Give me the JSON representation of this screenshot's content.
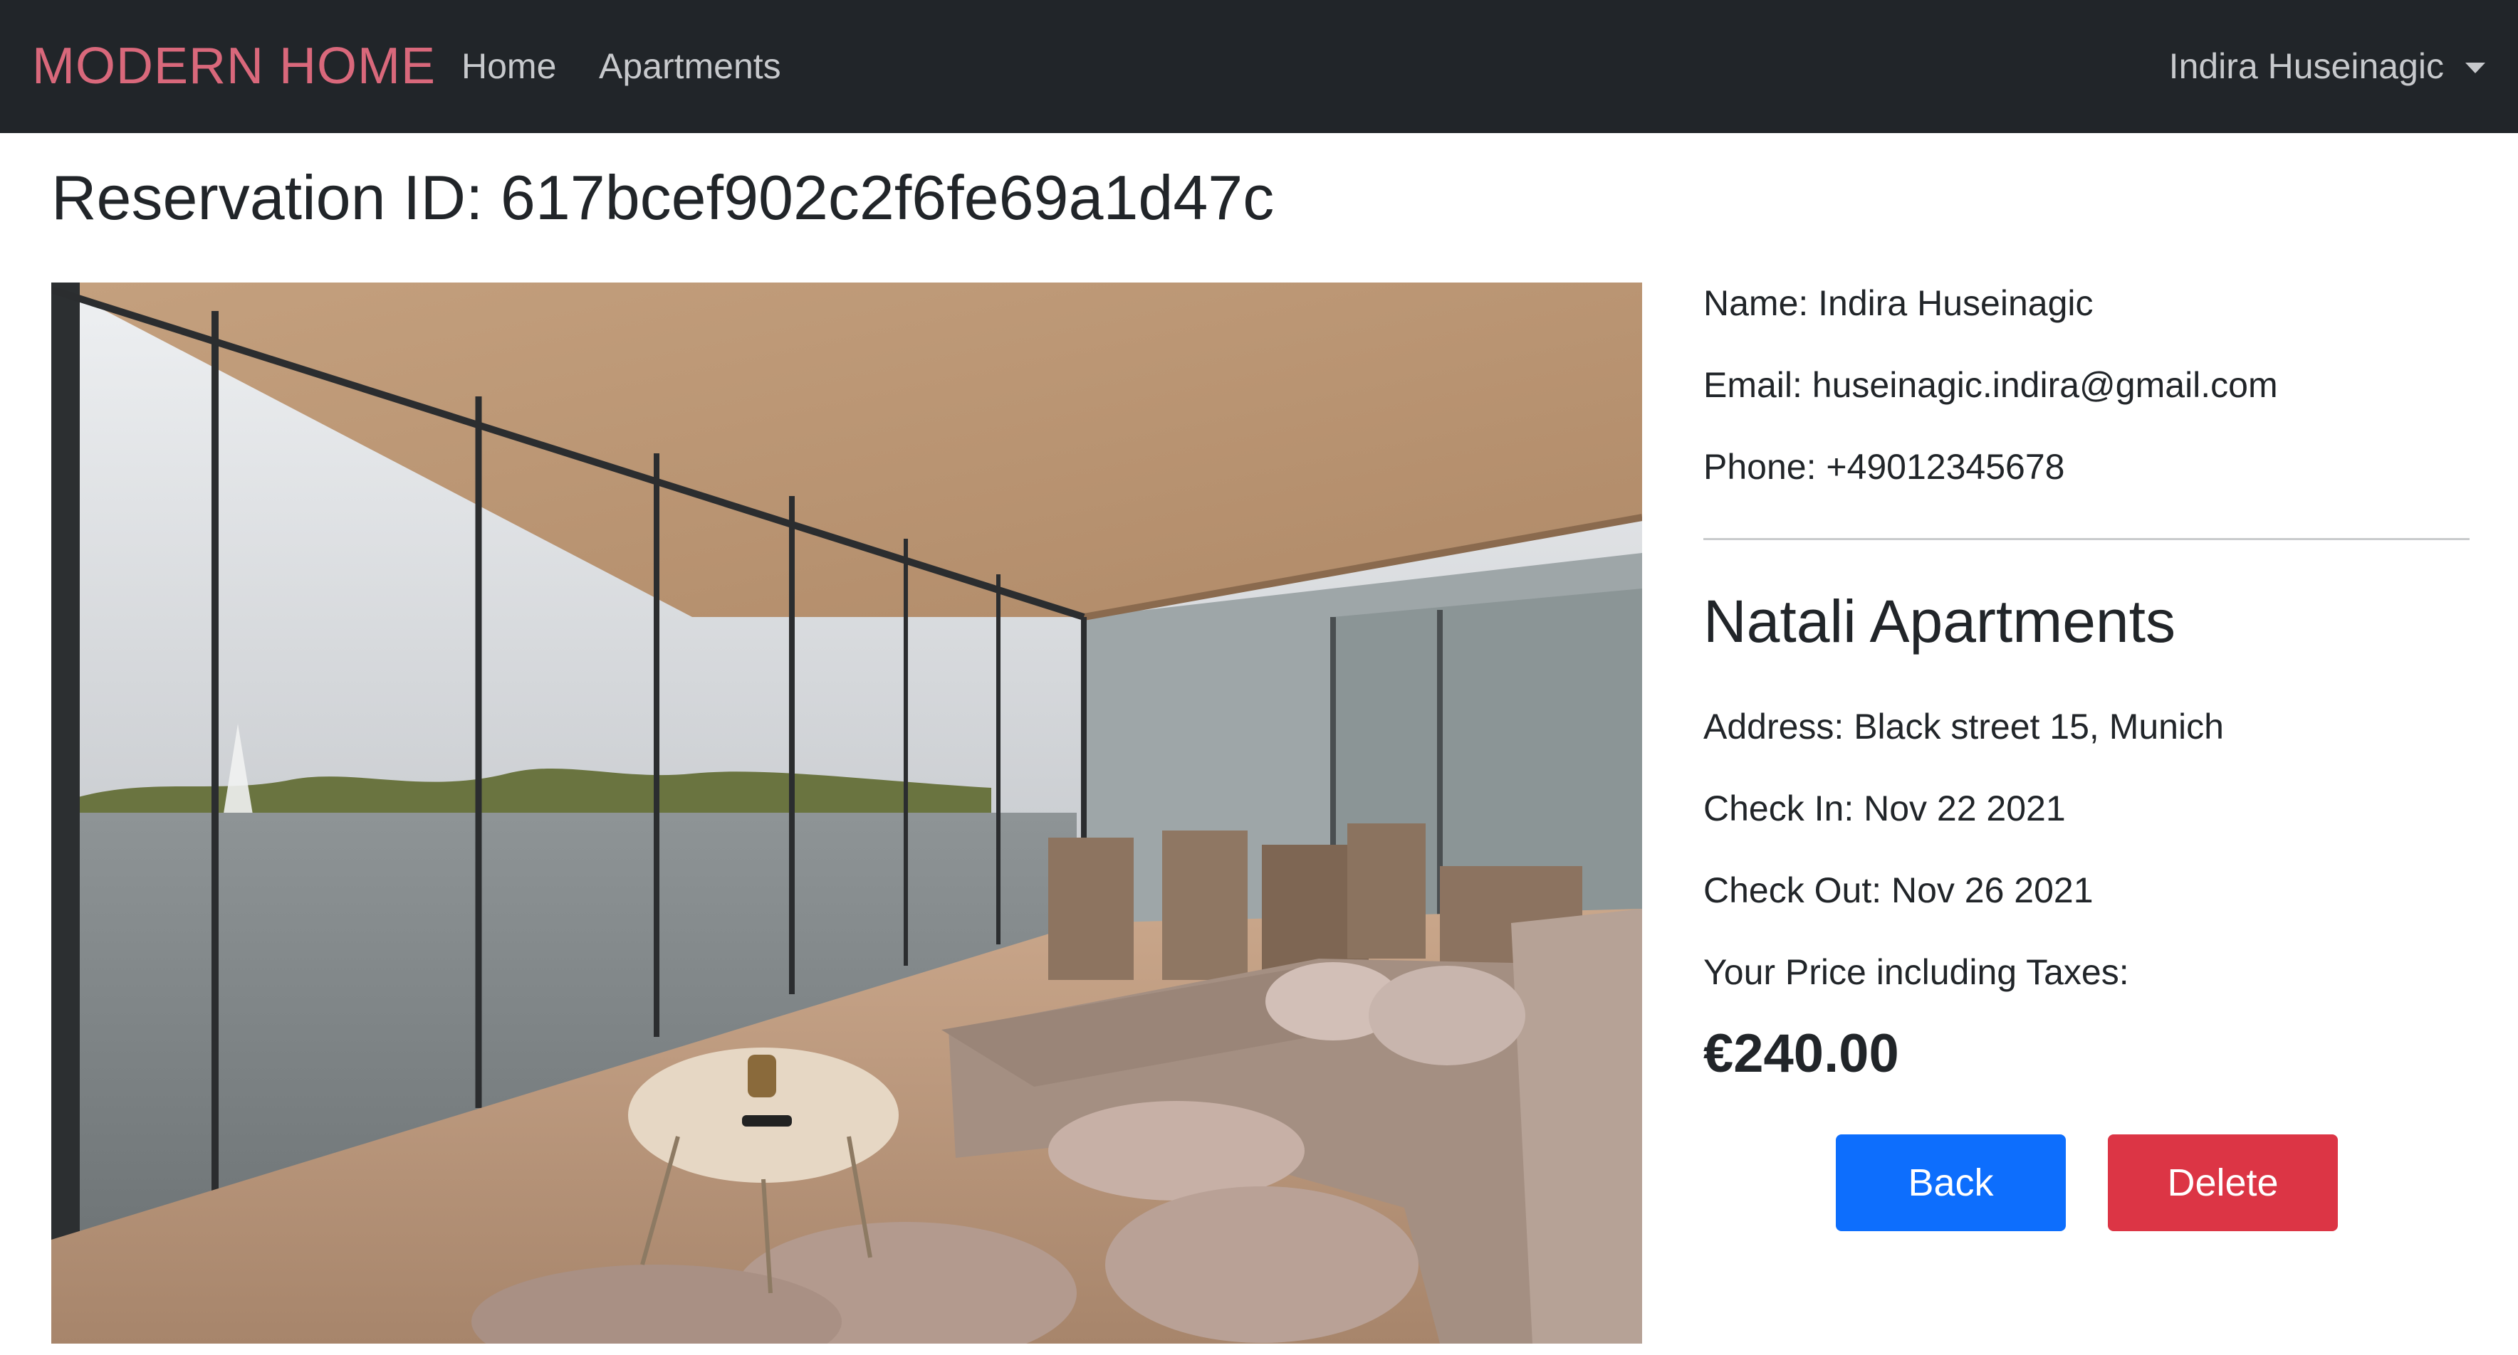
{
  "navbar": {
    "brand": "MODERN HOME",
    "links": [
      "Home",
      "Apartments"
    ],
    "user": "Indira Huseinagic"
  },
  "page": {
    "title": "Reservation ID: 617bcef902c2f6fe69a1d47c"
  },
  "guest": {
    "name": "Name: Indira Huseinagic",
    "email": "Email: huseinagic.indira@gmail.com",
    "phone": "Phone: +49012345678"
  },
  "apartment": {
    "name": "Natali Apartments",
    "address": "Address: Black street 15, Munich",
    "check_in": "Check In: Nov 22 2021",
    "check_out": "Check Out: Nov 26 2021",
    "price_label": "Your Price including Taxes:",
    "price": "€240.00"
  },
  "actions": {
    "back": "Back",
    "delete": "Delete"
  },
  "colors": {
    "navbar_bg": "#212529",
    "brand": "#d9687b",
    "back_button": "#0d6efd",
    "delete_button": "#dc3545"
  }
}
